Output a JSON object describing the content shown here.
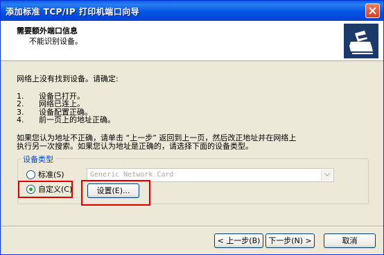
{
  "window": {
    "title": "添加标准 TCP/IP 打印机端口向导",
    "close_icon": "close-icon"
  },
  "header": {
    "title": "需要额外端口信息",
    "subtitle": "不能识别设备。",
    "icon": "printer-icon"
  },
  "body": {
    "intro": "网络上没有找到设备。请确定:",
    "list": [
      {
        "num": "1.",
        "text": "设备已打开。"
      },
      {
        "num": "2.",
        "text": "网络已连上。"
      },
      {
        "num": "3.",
        "text": "设备配置正确。"
      },
      {
        "num": "4.",
        "text": "前一页上的地址正确。"
      }
    ],
    "note_line1": "如果您认为地址不正确，请单击 “上一步” 返回到上一页，然后改正地址并在网络上",
    "note_line2": "执行另一次搜索。如果您认为地址是正确的，请选择下面的设备类型。"
  },
  "device_type": {
    "legend": "设备类型",
    "standard_label": "标准(S)",
    "standard_selected": false,
    "standard_combo_value": "Generic Network Card",
    "custom_label": "自定义(C)",
    "custom_selected": true,
    "settings_button": "设置(E)..."
  },
  "footer": {
    "back_button": "< 上一步(B)",
    "next_button": "下一步(N) >",
    "cancel_button": "取消"
  },
  "colors": {
    "titlebar": "#0055e5",
    "highlight": "#e00000",
    "legend": "#0046d5"
  }
}
